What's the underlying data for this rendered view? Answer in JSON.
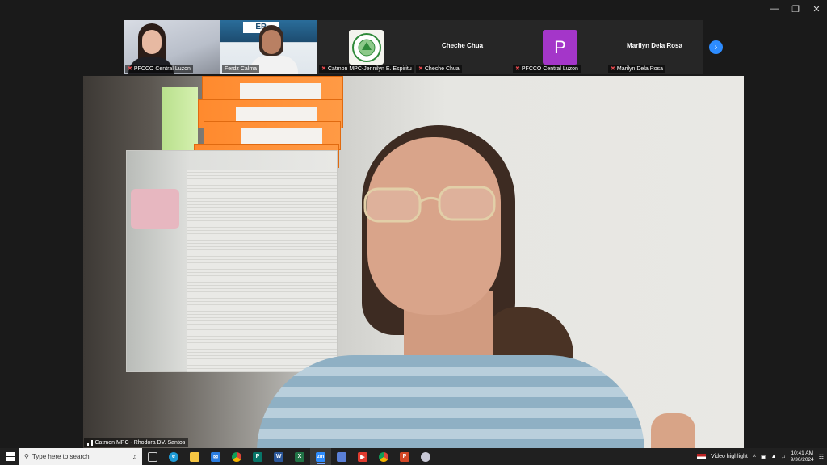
{
  "window": {
    "minimize_icon": "minimize-icon",
    "restore_icon": "restore-icon",
    "close_icon": "close-icon"
  },
  "participants": [
    {
      "name": "PFCCO Central Luzon",
      "muted": true,
      "type": "video"
    },
    {
      "name": "Ferdz Calma",
      "muted": false,
      "type": "video"
    },
    {
      "name": "Catmon MPC-Jennilyn E. Espiritu",
      "muted": true,
      "type": "logo",
      "logo_text": "CATMON MULTI-PURPOSE COOPERATIVE"
    },
    {
      "name": "Cheche Chua",
      "muted": true,
      "type": "name",
      "display_name": "Cheche Chua"
    },
    {
      "name": "PFCCO Central Luzon",
      "muted": true,
      "type": "avatar",
      "initial": "P"
    },
    {
      "name": "Marilyn Dela Rosa",
      "muted": true,
      "type": "name",
      "display_name": "Marilyn Dela Rosa"
    }
  ],
  "next_page_icon": "chevron-right-icon",
  "active_speaker": {
    "name": "Catmon MPC - Rhodora DV. Santos",
    "signal_icon": "signal-bars-icon"
  },
  "taskbar": {
    "search_placeholder": "Type here to search",
    "apps": [
      "task-view",
      "edge",
      "file-explorer",
      "mail",
      "chrome",
      "publisher",
      "word",
      "excel",
      "zoom",
      "photos",
      "video-editor",
      "chrome-2",
      "powerpoint",
      "snipping"
    ],
    "active_app": "zoom",
    "tray": {
      "weather_text": "Video highlight",
      "time": "10:41 AM",
      "date": "9/30/2024"
    }
  },
  "colors": {
    "zoom_blue": "#2d8cff",
    "avatar_purple": "#a436c9",
    "muted_red": "#e5484d"
  }
}
